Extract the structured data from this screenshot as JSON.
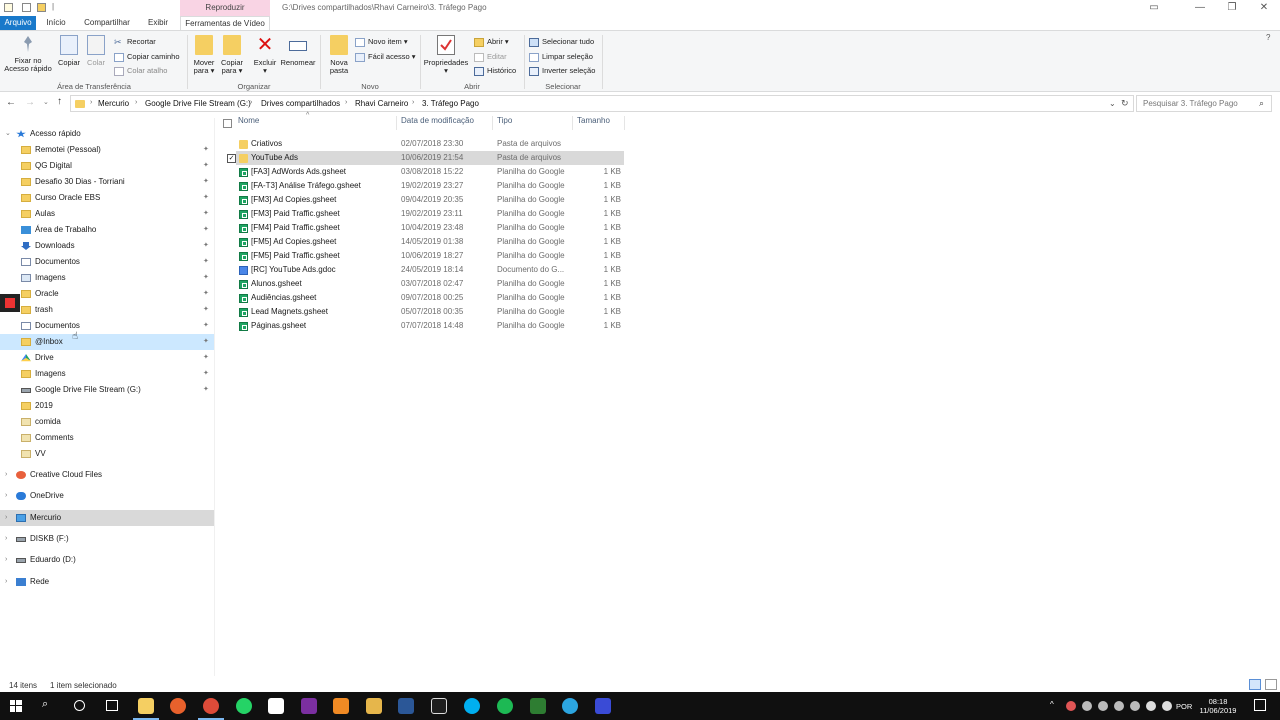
{
  "window": {
    "title": "G:\\Drives compartilhados\\Rhavi Carneiro\\3. Tráfego Pago",
    "contextual_tab_group": "Reproduzir"
  },
  "ribbon_tabs": [
    {
      "label": "Arquivo",
      "active": true
    },
    {
      "label": "Início"
    },
    {
      "label": "Compartilhar"
    },
    {
      "label": "Exibir"
    },
    {
      "label": "Ferramentas de Vídeo"
    }
  ],
  "ribbon": {
    "clipboard": {
      "pin_label_1": "Fixar no",
      "pin_label_2": "Acesso rápido",
      "copy": "Copiar",
      "paste": "Colar",
      "cut": "Recortar",
      "copy_path": "Copiar caminho",
      "paste_shortcut": "Colar atalho",
      "group": "Área de Transferência"
    },
    "organize": {
      "move_1": "Mover",
      "move_2": "para ▾",
      "copyto_1": "Copiar",
      "copyto_2": "para ▾",
      "delete_1": "Excluir",
      "delete_2": "▾",
      "rename": "Renomear",
      "group": "Organizar"
    },
    "new": {
      "new_folder_1": "Nova",
      "new_folder_2": "pasta",
      "new_item": "Novo item ▾",
      "easy_access": "Fácil acesso ▾",
      "group": "Novo"
    },
    "open": {
      "properties": "Propriedades",
      "properties_arrow": "▾",
      "open": "Abrir ▾",
      "edit": "Editar",
      "history": "Histórico",
      "group": "Abrir"
    },
    "select": {
      "select_all": "Selecionar tudo",
      "select_none": "Limpar seleção",
      "invert": "Inverter seleção",
      "group": "Selecionar"
    }
  },
  "address": {
    "crumbs": [
      "Mercurio",
      "Google Drive File Stream (G:)",
      "Drives compartilhados",
      "Rhavi Carneiro",
      "3. Tráfego Pago"
    ],
    "search_placeholder": "Pesquisar 3. Tráfego Pago"
  },
  "nav": {
    "quick_access": "Acesso rápido",
    "pinned": [
      {
        "label": "Remotei (Pessoal)",
        "icon": "folder"
      },
      {
        "label": "QG Digital",
        "icon": "folder"
      },
      {
        "label": "Desafio 30 Dias - Torriani",
        "icon": "folder"
      },
      {
        "label": "Curso Oracle EBS",
        "icon": "folder"
      },
      {
        "label": "Aulas",
        "icon": "folder"
      },
      {
        "label": "Área de Trabalho",
        "icon": "desktop"
      },
      {
        "label": "Downloads",
        "icon": "download"
      },
      {
        "label": "Documentos",
        "icon": "documents"
      },
      {
        "label": "Imagens",
        "icon": "pictures"
      },
      {
        "label": "Oracle",
        "icon": "folder"
      },
      {
        "label": "trash",
        "icon": "folder"
      },
      {
        "label": "Documentos",
        "icon": "documents"
      },
      {
        "label": "@Inbox",
        "icon": "folder"
      },
      {
        "label": "Drive",
        "icon": "drive"
      },
      {
        "label": "Imagens",
        "icon": "folder"
      },
      {
        "label": "Google Drive File Stream (G:)",
        "icon": "disk"
      }
    ],
    "recent": [
      {
        "label": "2019",
        "icon": "folder"
      },
      {
        "label": "comida",
        "icon": "user-folder"
      },
      {
        "label": "Comments",
        "icon": "user-folder"
      },
      {
        "label": "VV",
        "icon": "user-folder"
      }
    ],
    "roots": [
      {
        "label": "Creative Cloud Files",
        "icon": "cc"
      },
      {
        "label": "OneDrive",
        "icon": "cloud"
      },
      {
        "label": "Mercurio",
        "icon": "pc"
      },
      {
        "label": "DISKB (F:)",
        "icon": "disk"
      },
      {
        "label": "Eduardo (D:)",
        "icon": "disk"
      },
      {
        "label": "Rede",
        "icon": "network"
      }
    ]
  },
  "columns": {
    "name": "Nome",
    "date": "Data de modificação",
    "type": "Tipo",
    "size": "Tamanho"
  },
  "files": [
    {
      "name": "Criativos",
      "date": "02/07/2018 23:30",
      "type": "Pasta de arquivos",
      "size": "",
      "icon": "folder"
    },
    {
      "name": "YouTube Ads",
      "date": "10/06/2019 21:54",
      "type": "Pasta de arquivos",
      "size": "",
      "icon": "folder",
      "selected": true
    },
    {
      "name": "[FA3] AdWords Ads.gsheet",
      "date": "03/08/2018 15:22",
      "type": "Planilha do Google",
      "size": "1 KB",
      "icon": "gsheet"
    },
    {
      "name": "[FA-T3] Análise Tráfego.gsheet",
      "date": "19/02/2019 23:27",
      "type": "Planilha do Google",
      "size": "1 KB",
      "icon": "gsheet"
    },
    {
      "name": "[FM3] Ad Copies.gsheet",
      "date": "09/04/2019 20:35",
      "type": "Planilha do Google",
      "size": "1 KB",
      "icon": "gsheet"
    },
    {
      "name": "[FM3] Paid Traffic.gsheet",
      "date": "19/02/2019 23:11",
      "type": "Planilha do Google",
      "size": "1 KB",
      "icon": "gsheet"
    },
    {
      "name": "[FM4] Paid Traffic.gsheet",
      "date": "10/04/2019 23:48",
      "type": "Planilha do Google",
      "size": "1 KB",
      "icon": "gsheet"
    },
    {
      "name": "[FM5] Ad Copies.gsheet",
      "date": "14/05/2019 01:38",
      "type": "Planilha do Google",
      "size": "1 KB",
      "icon": "gsheet"
    },
    {
      "name": "[FM5] Paid Traffic.gsheet",
      "date": "10/06/2019 18:27",
      "type": "Planilha do Google",
      "size": "1 KB",
      "icon": "gsheet"
    },
    {
      "name": "[RC] YouTube Ads.gdoc",
      "date": "24/05/2019 18:14",
      "type": "Documento do G...",
      "size": "1 KB",
      "icon": "gdoc"
    },
    {
      "name": "Alunos.gsheet",
      "date": "03/07/2018 02:47",
      "type": "Planilha do Google",
      "size": "1 KB",
      "icon": "gsheet"
    },
    {
      "name": "Audiências.gsheet",
      "date": "09/07/2018 00:25",
      "type": "Planilha do Google",
      "size": "1 KB",
      "icon": "gsheet"
    },
    {
      "name": "Lead Magnets.gsheet",
      "date": "05/07/2018 00:35",
      "type": "Planilha do Google",
      "size": "1 KB",
      "icon": "gsheet"
    },
    {
      "name": "Páginas.gsheet",
      "date": "07/07/2018 14:48",
      "type": "Planilha do Google",
      "size": "1 KB",
      "icon": "gsheet"
    }
  ],
  "status": {
    "count": "14 itens",
    "selected": "1 item selecionado"
  },
  "taskbar": {
    "lang": "POR",
    "time": "08:18",
    "date": "11/06/2019"
  },
  "colors": {
    "accent": "#1979ca",
    "selection": "#d9d9d9",
    "folder": "#f5cf62",
    "gsheet": "#1fa463",
    "gdoc": "#4a86e8"
  }
}
